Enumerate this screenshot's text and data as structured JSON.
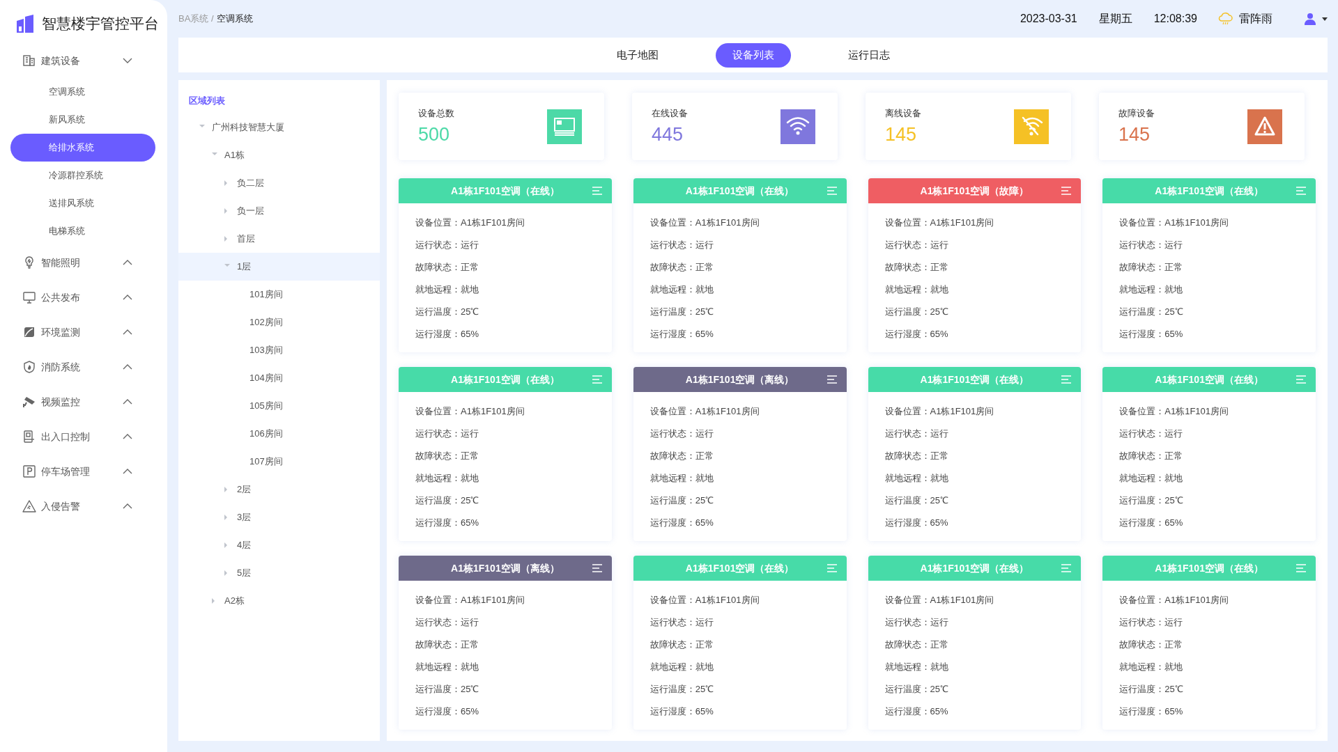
{
  "app": {
    "title": "智慧楼宇管控平台"
  },
  "sidebar": {
    "items": [
      {
        "label": "建筑设备",
        "expanded": true,
        "children": [
          {
            "label": "空调系统",
            "selected": false
          },
          {
            "label": "新风系统",
            "selected": false
          },
          {
            "label": "给排水系统",
            "selected": true
          },
          {
            "label": "冷源群控系统",
            "selected": false
          },
          {
            "label": "送排风系统",
            "selected": false
          },
          {
            "label": "电梯系统",
            "selected": false
          }
        ]
      },
      {
        "label": "智能照明",
        "expanded": false
      },
      {
        "label": "公共发布",
        "expanded": false
      },
      {
        "label": "环境监测",
        "expanded": false
      },
      {
        "label": "消防系统",
        "expanded": false
      },
      {
        "label": "视频监控",
        "expanded": false
      },
      {
        "label": "出入口控制",
        "expanded": false
      },
      {
        "label": "停车场管理",
        "expanded": false
      },
      {
        "label": "入侵告警",
        "expanded": false
      }
    ]
  },
  "breadcrumb": [
    "BA系统 /",
    "空调系统"
  ],
  "header": {
    "date": "2023-03-31",
    "weekday": "星期五",
    "time": "12:08:39",
    "weather": "雷阵雨"
  },
  "tabs": [
    {
      "label": "电子地图",
      "selected": false
    },
    {
      "label": "设备列表",
      "selected": true
    },
    {
      "label": "运行日志",
      "selected": false
    }
  ],
  "tree": {
    "title": "区域列表",
    "items": [
      {
        "label": "广州科技智慧大厦",
        "kind": "node",
        "expanded": true,
        "selected": false,
        "children": [
          {
            "label": "A1栋",
            "kind": "node",
            "expanded": true,
            "selected": false,
            "children": [
              {
                "label": "负二层",
                "kind": "node",
                "expanded": false,
                "selected": false
              },
              {
                "label": "负一层",
                "kind": "node",
                "expanded": false,
                "selected": false
              },
              {
                "label": "首层",
                "kind": "node",
                "expanded": false,
                "selected": false
              },
              {
                "label": "1层",
                "kind": "node",
                "expanded": true,
                "selected": true,
                "children": [
                  {
                    "label": "101房间",
                    "kind": "leaf",
                    "selected": false
                  },
                  {
                    "label": "102房间",
                    "kind": "leaf",
                    "selected": false
                  },
                  {
                    "label": "103房间",
                    "kind": "leaf",
                    "selected": false
                  },
                  {
                    "label": "104房间",
                    "kind": "leaf",
                    "selected": false
                  },
                  {
                    "label": "105房间",
                    "kind": "leaf",
                    "selected": false
                  },
                  {
                    "label": "106房间",
                    "kind": "leaf",
                    "selected": false
                  },
                  {
                    "label": "107房间",
                    "kind": "leaf",
                    "selected": false
                  }
                ]
              },
              {
                "label": "2层",
                "kind": "node",
                "expanded": false,
                "selected": false
              },
              {
                "label": "3层",
                "kind": "node",
                "expanded": false,
                "selected": false
              },
              {
                "label": "4层",
                "kind": "node",
                "expanded": false,
                "selected": false
              },
              {
                "label": "5层",
                "kind": "node",
                "expanded": false,
                "selected": false
              }
            ]
          },
          {
            "label": "A2栋",
            "kind": "node",
            "expanded": false,
            "selected": false
          }
        ]
      }
    ]
  },
  "stats": [
    {
      "label": "设备总数",
      "value": "500",
      "kind": "total",
      "color": "#4cd9a7"
    },
    {
      "label": "在线设备",
      "value": "445",
      "kind": "online",
      "color": "#7f77dd"
    },
    {
      "label": "离线设备",
      "value": "145",
      "kind": "offline",
      "color": "#f5c125"
    },
    {
      "label": "故障设备",
      "value": "145",
      "kind": "fault",
      "color": "#d9734d"
    }
  ],
  "devices": [
    {
      "title": "A1栋1F101空调（在线）",
      "kind": "online",
      "fields": [
        "设备位置：A1栋1F101房间",
        "运行状态：运行",
        "故障状态：正常",
        "就地远程：就地",
        "运行温度：25℃",
        "运行湿度：65%"
      ]
    },
    {
      "title": "A1栋1F101空调（在线）",
      "kind": "online",
      "fields": [
        "设备位置：A1栋1F101房间",
        "运行状态：运行",
        "故障状态：正常",
        "就地远程：就地",
        "运行温度：25℃",
        "运行湿度：65%"
      ]
    },
    {
      "title": "A1栋1F101空调（故障）",
      "kind": "fault",
      "fields": [
        "设备位置：A1栋1F101房间",
        "运行状态：运行",
        "故障状态：正常",
        "就地远程：就地",
        "运行温度：25℃",
        "运行湿度：65%"
      ]
    },
    {
      "title": "A1栋1F101空调（在线）",
      "kind": "online",
      "fields": [
        "设备位置：A1栋1F101房间",
        "运行状态：运行",
        "故障状态：正常",
        "就地远程：就地",
        "运行温度：25℃",
        "运行湿度：65%"
      ]
    },
    {
      "title": "A1栋1F101空调（在线）",
      "kind": "online",
      "fields": [
        "设备位置：A1栋1F101房间",
        "运行状态：运行",
        "故障状态：正常",
        "就地远程：就地",
        "运行温度：25℃",
        "运行湿度：65%"
      ]
    },
    {
      "title": "A1栋1F101空调（离线）",
      "kind": "offline",
      "fields": [
        "设备位置：A1栋1F101房间",
        "运行状态：运行",
        "故障状态：正常",
        "就地远程：就地",
        "运行温度：25℃",
        "运行湿度：65%"
      ]
    },
    {
      "title": "A1栋1F101空调（在线）",
      "kind": "online",
      "fields": [
        "设备位置：A1栋1F101房间",
        "运行状态：运行",
        "故障状态：正常",
        "就地远程：就地",
        "运行温度：25℃",
        "运行湿度：65%"
      ]
    },
    {
      "title": "A1栋1F101空调（在线）",
      "kind": "online",
      "fields": [
        "设备位置：A1栋1F101房间",
        "运行状态：运行",
        "故障状态：正常",
        "就地远程：就地",
        "运行温度：25℃",
        "运行湿度：65%"
      ]
    },
    {
      "title": "A1栋1F101空调（离线）",
      "kind": "offline",
      "fields": [
        "设备位置：A1栋1F101房间",
        "运行状态：运行",
        "故障状态：正常",
        "就地远程：就地",
        "运行温度：25℃",
        "运行湿度：65%"
      ]
    },
    {
      "title": "A1栋1F101空调（在线）",
      "kind": "online",
      "fields": [
        "设备位置：A1栋1F101房间",
        "运行状态：运行",
        "故障状态：正常",
        "就地远程：就地",
        "运行温度：25℃",
        "运行湿度：65%"
      ]
    },
    {
      "title": "A1栋1F101空调（在线）",
      "kind": "online",
      "fields": [
        "设备位置：A1栋1F101房间",
        "运行状态：运行",
        "故障状态：正常",
        "就地远程：就地",
        "运行温度：25℃",
        "运行湿度：65%"
      ]
    },
    {
      "title": "A1栋1F101空调（在线）",
      "kind": "online",
      "fields": [
        "设备位置：A1栋1F101房间",
        "运行状态：运行",
        "故障状态：正常",
        "就地远程：就地",
        "运行温度：25℃",
        "运行湿度：65%"
      ]
    }
  ]
}
